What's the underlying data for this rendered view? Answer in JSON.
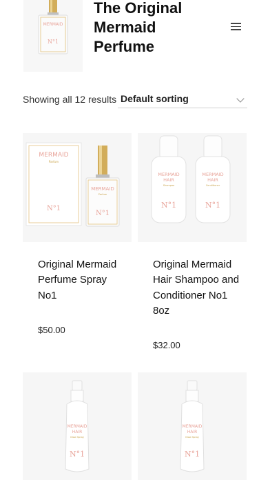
{
  "header": {
    "title": "The Original Mermaid Perfume",
    "menu_icon": "hamburger-icon",
    "logo_text": "MERMAID",
    "logo_number": "N°1"
  },
  "toolbar": {
    "result_count": "Showing all 12 results",
    "sorting_value": "Default sorting"
  },
  "products": [
    {
      "title": "Original Mermaid Perfume Spray No1",
      "price": "$50.00",
      "box_text": "MERMAID",
      "box_sub": "Parfum",
      "box_number": "N°1",
      "bottle_text": "MERMAID",
      "bottle_sub": "Parfum",
      "bottle_number": "N°1"
    },
    {
      "title": "Original Mermaid Hair Shampoo and Conditioner No1 8oz",
      "price": "$32.00",
      "left_line1": "MERMAID",
      "left_line2": "HAIR",
      "left_sub": "Shampoo",
      "left_number": "N°1",
      "right_line1": "MERMAID",
      "right_line2": "HAIR",
      "right_sub": "Conditioner",
      "right_number": "N°1"
    },
    {
      "line1": "MERMAID",
      "line2": "HAIR",
      "sub": "Glow Spray",
      "number": "N°1"
    },
    {
      "line1": "MERMAID",
      "line2": "HAIR",
      "sub": "Glow Spray",
      "number": "N°1"
    }
  ],
  "colors": {
    "accent_pink": "#e8a49a",
    "gold": "#c9a34a"
  }
}
